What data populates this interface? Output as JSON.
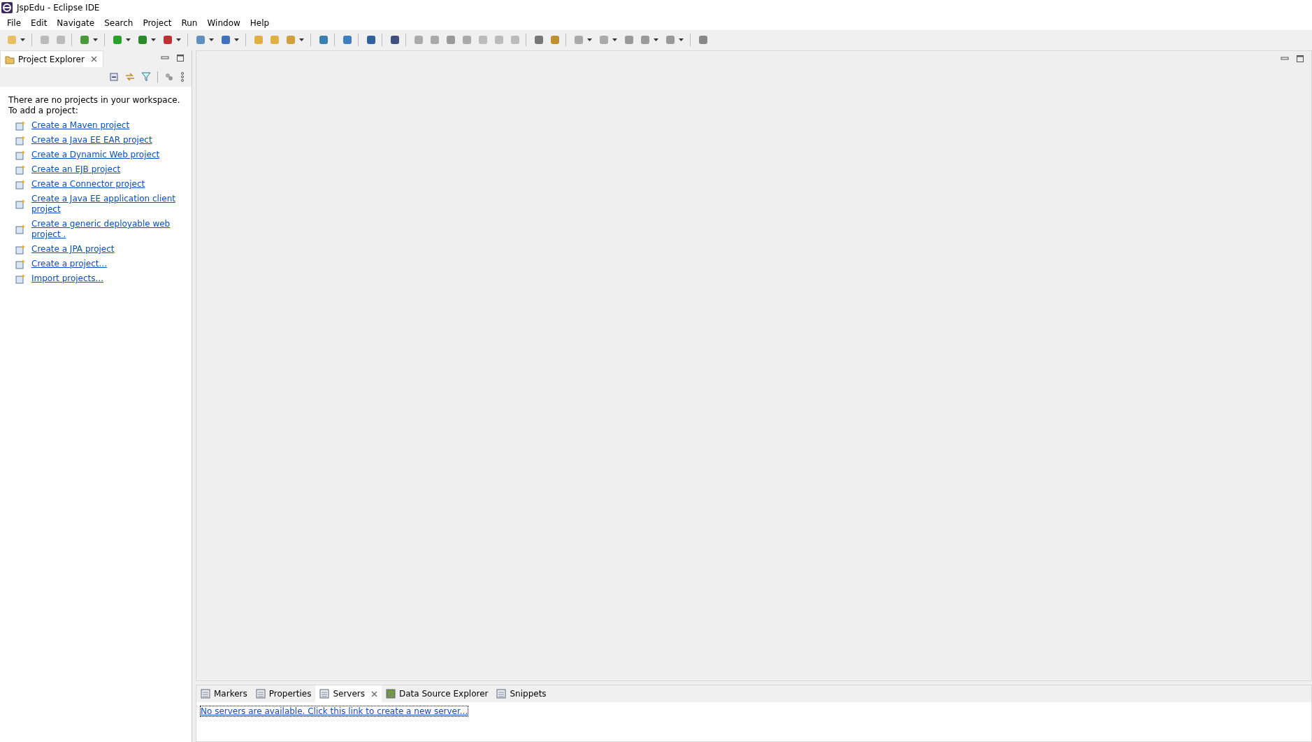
{
  "window": {
    "title": "JspEdu - Eclipse IDE"
  },
  "menu": [
    "File",
    "Edit",
    "Navigate",
    "Search",
    "Project",
    "Run",
    "Window",
    "Help"
  ],
  "project_explorer": {
    "title": "Project Explorer",
    "message": [
      "There are no projects in your workspace.",
      "To add a project:"
    ],
    "links": [
      "Create a Maven project",
      "Create a Java EE EAR project",
      "Create a Dynamic Web project",
      "Create an EJB project",
      "Create a Connector project",
      "Create a Java EE application client project",
      "Create a generic deployable web project .",
      "Create a JPA project",
      "Create a project...",
      "Import projects..."
    ]
  },
  "bottom_panel": {
    "tabs": [
      {
        "label": "Markers",
        "selected": false
      },
      {
        "label": "Properties",
        "selected": false
      },
      {
        "label": "Servers",
        "selected": true
      },
      {
        "label": "Data Source Explorer",
        "selected": false
      },
      {
        "label": "Snippets",
        "selected": false
      }
    ],
    "message": "No servers are available. Click this link to create a new server..."
  }
}
